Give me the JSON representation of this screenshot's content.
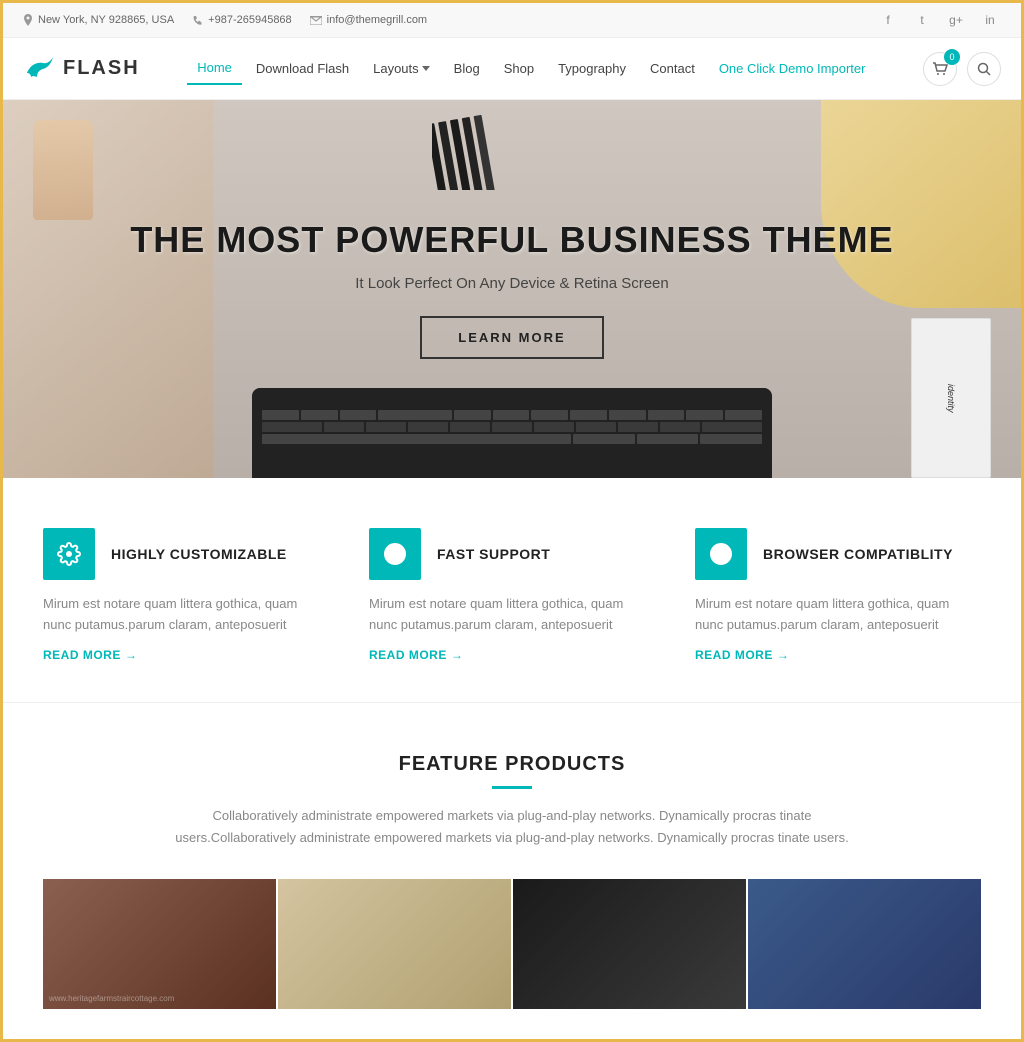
{
  "topbar": {
    "location": "New York, NY 928865, USA",
    "phone": "+987-265945868",
    "email": "info@themegrill.com",
    "socials": [
      {
        "name": "facebook",
        "symbol": "f"
      },
      {
        "name": "twitter",
        "symbol": "t"
      },
      {
        "name": "google-plus",
        "symbol": "g+"
      },
      {
        "name": "linkedin",
        "symbol": "in"
      }
    ]
  },
  "header": {
    "logo_text": "FLASH",
    "nav_items": [
      {
        "label": "Home",
        "active": true
      },
      {
        "label": "Download Flash",
        "active": false
      },
      {
        "label": "Layouts",
        "active": false,
        "has_dropdown": true
      },
      {
        "label": "Blog",
        "active": false
      },
      {
        "label": "Shop",
        "active": false
      },
      {
        "label": "Typography",
        "active": false
      },
      {
        "label": "Contact",
        "active": false
      },
      {
        "label": "One Click Demo Importer",
        "active": false,
        "highlight": true
      }
    ],
    "cart_count": "0"
  },
  "hero": {
    "title": "THE MOST POWERFUL BUSINESS THEME",
    "subtitle": "It Look Perfect On Any Device & Retina Screen",
    "button_label": "LEARN MORE"
  },
  "features": [
    {
      "icon": "gear",
      "title": "HIGHLY CUSTOMIZABLE",
      "description": "Mirum est notare quam littera gothica, quam nunc putamus.parum claram, anteposuerit",
      "read_more": "READ MORE"
    },
    {
      "icon": "headset",
      "title": "FAST SUPPORT",
      "description": "Mirum est notare quam littera gothica, quam nunc putamus.parum claram, anteposuerit",
      "read_more": "READ MORE"
    },
    {
      "icon": "browser",
      "title": "BROWSER COMPATIBLITY",
      "description": "Mirum est notare quam littera gothica, quam nunc putamus.parum claram, anteposuerit",
      "read_more": "READ MORE"
    }
  ],
  "products_section": {
    "title": "FEATURE PRODUCTS",
    "description": "Collaboratively administrate empowered markets via plug-and-play networks. Dynamically procras tinate users.Collaboratively administrate empowered markets via plug-and-play networks. Dynamically procras tinate users."
  },
  "colors": {
    "accent": "#00b8b8",
    "dark": "#222222",
    "text": "#888888"
  }
}
